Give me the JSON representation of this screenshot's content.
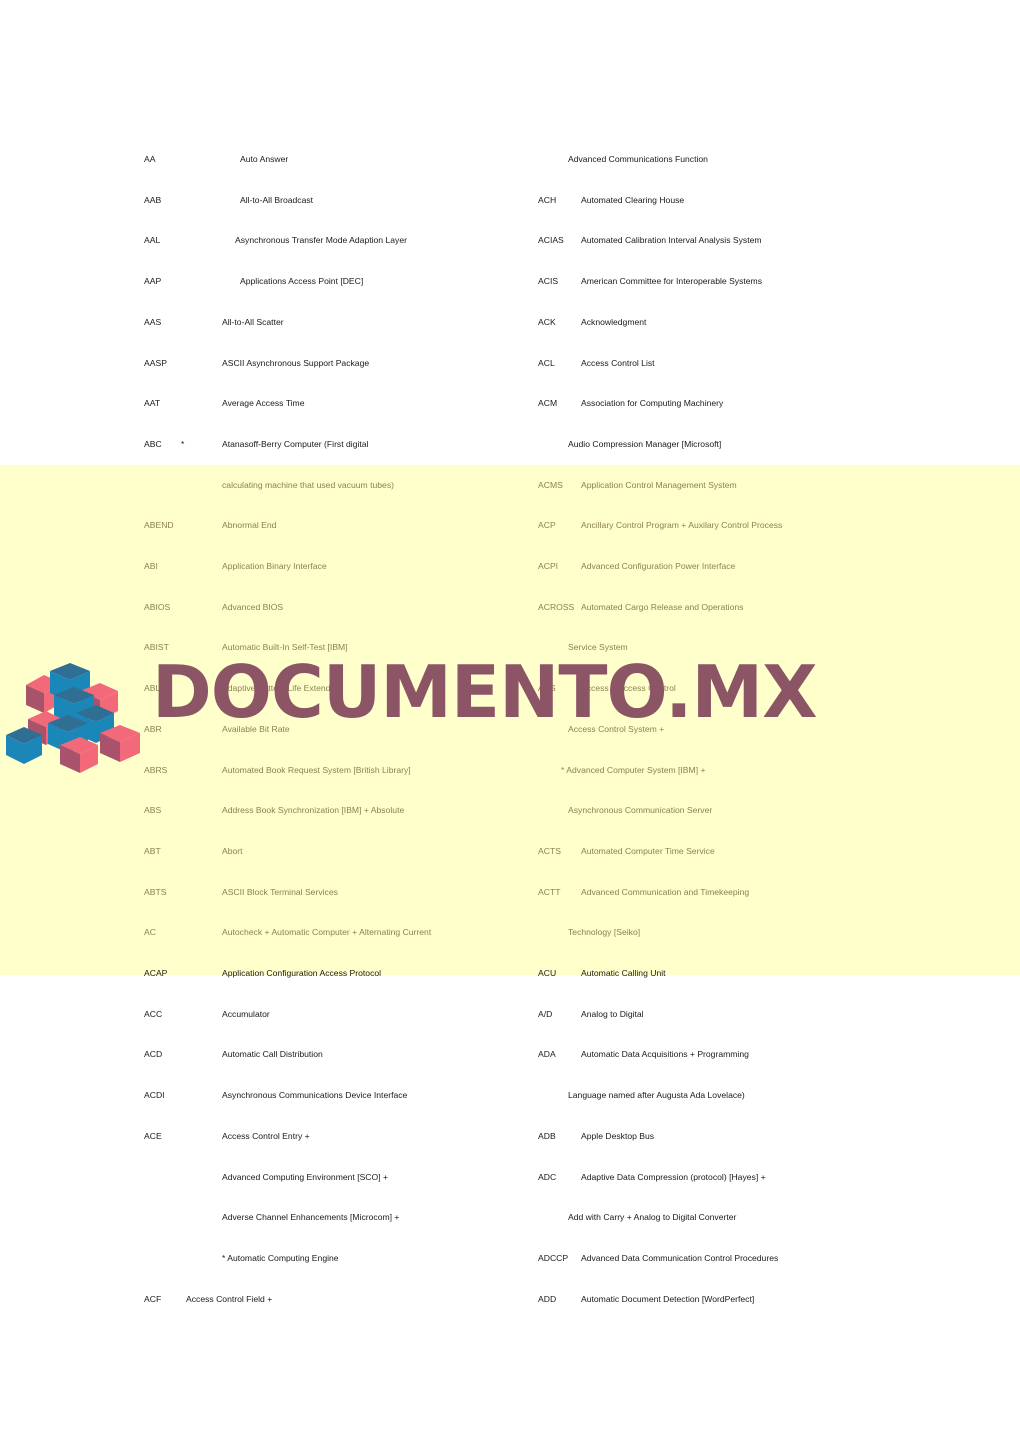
{
  "document": {
    "kind": "acronym-glossary-page",
    "page_background": "#ffffff",
    "highlight_color": "#ffffcc",
    "highlight_text_color": "#8a8254",
    "body_text_color": "#1a1a1a"
  },
  "watermark": {
    "text": "DOCUMENTO.MX",
    "color": "#8c5566",
    "logo_name": "stacked-cubes-logo",
    "logo_colors": [
      "#1b86b8",
      "#f2697a",
      "#a8536b",
      "#2e6f93"
    ]
  },
  "rows": [
    {
      "highlighted": false,
      "left": {
        "abbr": "AA",
        "star": "",
        "def": "Auto Answer",
        "indent": "wide"
      },
      "right": {
        "abbr": "",
        "def": "Advanced Communications Function",
        "indent": "yes"
      }
    },
    {
      "highlighted": false,
      "left": {
        "abbr": "AAB",
        "star": "",
        "def": "All-to-All Broadcast",
        "indent": "wide"
      },
      "right": {
        "abbr": "ACH",
        "def": "Automated Clearing House",
        "indent": "no"
      }
    },
    {
      "highlighted": false,
      "left": {
        "abbr": "AAL",
        "star": "",
        "def": "Asynchronous Transfer Mode Adaption Layer",
        "indent": "mid"
      },
      "right": {
        "abbr": "ACIAS",
        "def": "Automated Calibration Interval Analysis System",
        "indent": "no"
      }
    },
    {
      "highlighted": false,
      "left": {
        "abbr": "AAP",
        "star": "",
        "def": "Applications Access Point [DEC]",
        "indent": "wide"
      },
      "right": {
        "abbr": "ACIS",
        "def": "American Committee for Interoperable Systems",
        "indent": "no"
      }
    },
    {
      "highlighted": false,
      "left": {
        "abbr": "AAS",
        "star": "",
        "def": "All-to-All Scatter",
        "indent": "no"
      },
      "right": {
        "abbr": "ACK",
        "def": "Acknowledgment",
        "indent": "no"
      }
    },
    {
      "highlighted": false,
      "left": {
        "abbr": "AASP",
        "star": "",
        "def": "ASCII Asynchronous Support Package",
        "indent": "no"
      },
      "right": {
        "abbr": "ACL",
        "def": "Access Control List",
        "indent": "no"
      }
    },
    {
      "highlighted": false,
      "left": {
        "abbr": "AAT",
        "star": "",
        "def": "Average Access Time",
        "indent": "no"
      },
      "right": {
        "abbr": "ACM",
        "def": "Association for Computing Machinery",
        "indent": "no"
      }
    },
    {
      "highlighted": false,
      "left": {
        "abbr": "ABC",
        "star": "*",
        "def": "Atanasoff-Berry Computer  (First digital",
        "indent": "no"
      },
      "right": {
        "abbr": "",
        "def": "Audio Compression Manager [Microsoft]",
        "indent": "yes"
      }
    },
    {
      "highlighted": true,
      "left": {
        "abbr": "",
        "star": "",
        "def": "calculating machine that used vacuum tubes)",
        "indent": "no"
      },
      "right": {
        "abbr": "ACMS",
        "def": "Application Control Management System",
        "indent": "no"
      }
    },
    {
      "highlighted": true,
      "left": {
        "abbr": "ABEND",
        "star": "",
        "def": "Abnormal End",
        "indent": "no"
      },
      "right": {
        "abbr": "ACP",
        "def": "Ancillary Control Program + Auxilary Control Process",
        "indent": "no"
      }
    },
    {
      "highlighted": true,
      "left": {
        "abbr": "ABI",
        "star": "",
        "def": "Application Binary Interface",
        "indent": "no"
      },
      "right": {
        "abbr": "ACPI",
        "def": "Advanced Configuration Power Interface",
        "indent": "no"
      }
    },
    {
      "highlighted": true,
      "left": {
        "abbr": "ABIOS",
        "star": "",
        "def": "Advanced BIOS",
        "indent": "no"
      },
      "right": {
        "abbr": "ACROSS",
        "def": "Automated Cargo Release and Operations",
        "indent": "no"
      }
    },
    {
      "highlighted": true,
      "left": {
        "abbr": "ABIST",
        "star": "",
        "def": "Automatic Built-In Self-Test [IBM]",
        "indent": "no"
      },
      "right": {
        "abbr": "",
        "def": "Service System",
        "indent": "yes"
      }
    },
    {
      "highlighted": true,
      "left": {
        "abbr": "ABLE",
        "star": "",
        "def": "Adaptive Battery Life Extender",
        "indent": "no"
      },
      "right": {
        "abbr": "ACS",
        "def": "Access + Access Control",
        "indent": "no"
      }
    },
    {
      "highlighted": true,
      "left": {
        "abbr": "ABR",
        "star": "",
        "def": "Available Bit Rate",
        "indent": "no"
      },
      "right": {
        "abbr": "",
        "def": "Access Control System +",
        "indent": "yes"
      }
    },
    {
      "highlighted": true,
      "left": {
        "abbr": "ABRS",
        "star": "",
        "def": "Automated Book Request System [British Library]",
        "indent": "no"
      },
      "right": {
        "abbr": "",
        "def": "* Advanced Computer System [IBM] +",
        "indent": "star"
      }
    },
    {
      "highlighted": true,
      "left": {
        "abbr": "ABS",
        "star": "",
        "def": "Address Book Synchronization [IBM] + Absolute",
        "indent": "no"
      },
      "right": {
        "abbr": "",
        "def": "Asynchronous Communication Server",
        "indent": "yes"
      }
    },
    {
      "highlighted": true,
      "left": {
        "abbr": "ABT",
        "star": "",
        "def": "Abort",
        "indent": "no"
      },
      "right": {
        "abbr": "ACTS",
        "def": "Automated Computer Time Service",
        "indent": "no"
      }
    },
    {
      "highlighted": true,
      "left": {
        "abbr": "ABTS",
        "star": "",
        "def": "ASCII Block Terminal Services",
        "indent": "no"
      },
      "right": {
        "abbr": "ACTT",
        "def": "Advanced Communication and Timekeeping",
        "indent": "no"
      }
    },
    {
      "highlighted": true,
      "left": {
        "abbr": "AC",
        "star": "",
        "def": "Autocheck + Automatic Computer + Alternating Current",
        "indent": "no"
      },
      "right": {
        "abbr": "",
        "def": "Technology [Seiko]",
        "indent": "yes"
      }
    },
    {
      "highlighted": false,
      "left": {
        "abbr": "ACAP",
        "star": "",
        "def": "Application Configuration Access Protocol",
        "indent": "no"
      },
      "right": {
        "abbr": "ACU",
        "def": "Automatic Calling Unit",
        "indent": "no"
      }
    },
    {
      "highlighted": false,
      "left": {
        "abbr": "ACC",
        "star": "",
        "def": "Accumulator",
        "indent": "no"
      },
      "right": {
        "abbr": "A/D",
        "def": "Analog to Digital",
        "indent": "no"
      }
    },
    {
      "highlighted": false,
      "left": {
        "abbr": "ACD",
        "star": "",
        "def": "Automatic Call Distribution",
        "indent": "no"
      },
      "right": {
        "abbr": "ADA",
        "def": "Automatic Data Acquisitions + Programming",
        "indent": "no"
      }
    },
    {
      "highlighted": false,
      "left": {
        "abbr": "ACDI",
        "star": "",
        "def": "Asynchronous Communications Device Interface",
        "indent": "no"
      },
      "right": {
        "abbr": "",
        "def": "Language named after Augusta Ada Lovelace)",
        "indent": "yes"
      }
    },
    {
      "highlighted": false,
      "left": {
        "abbr": "ACE",
        "star": "",
        "def": "Access Control Entry +",
        "indent": "no"
      },
      "right": {
        "abbr": "ADB",
        "def": "Apple Desktop Bus",
        "indent": "no"
      }
    },
    {
      "highlighted": false,
      "left": {
        "abbr": "",
        "star": "",
        "def": "Advanced Computing Environment [SCO] +",
        "indent": "no"
      },
      "right": {
        "abbr": "ADC",
        "def": "Adaptive Data Compression (protocol) [Hayes] +",
        "indent": "no"
      }
    },
    {
      "highlighted": false,
      "left": {
        "abbr": "",
        "star": "",
        "def": "Adverse Channel Enhancements [Microcom] +",
        "indent": "no"
      },
      "right": {
        "abbr": "",
        "def": "Add with Carry + Analog to Digital Converter",
        "indent": "yes"
      }
    },
    {
      "highlighted": false,
      "left": {
        "abbr": "",
        "star": "",
        "def": "*  Automatic Computing Engine",
        "indent": "star"
      },
      "right": {
        "abbr": "ADCCP",
        "def": "Advanced Data Communication Control Procedures",
        "indent": "no"
      }
    },
    {
      "highlighted": false,
      "left": {
        "abbr": "ACF",
        "star": "",
        "def": "Access Control Field +",
        "indent": "narrow"
      },
      "right": {
        "abbr": "ADD",
        "def": "Automatic Document Detection [WordPerfect]",
        "indent": "no"
      }
    }
  ]
}
